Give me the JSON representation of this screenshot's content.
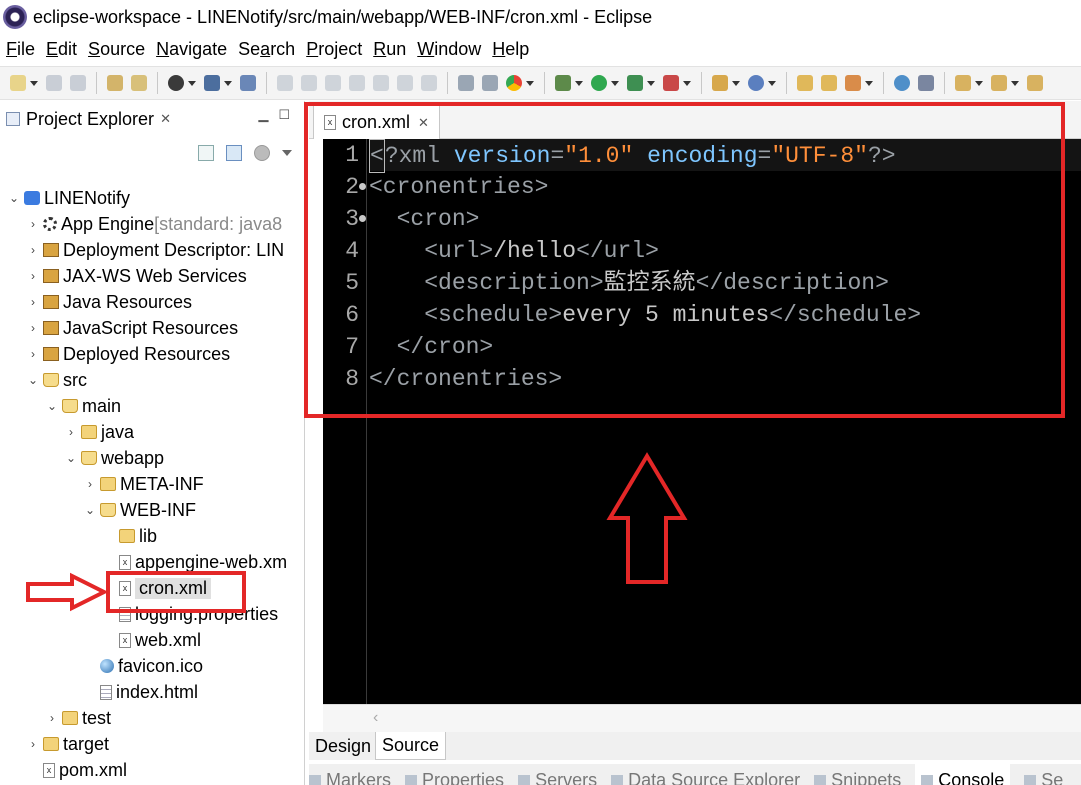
{
  "window": {
    "title": "eclipse-workspace - LINENotify/src/main/webapp/WEB-INF/cron.xml - Eclipse"
  },
  "menu": [
    {
      "label": "File",
      "mnemonic": "F",
      "rest": "ile"
    },
    {
      "label": "Edit",
      "mnemonic": "E",
      "rest": "dit"
    },
    {
      "label": "Source",
      "mnemonic": "S",
      "rest": "ource"
    },
    {
      "label": "Navigate",
      "mnemonic": "N",
      "rest": "avigate"
    },
    {
      "label": "Search",
      "pre": "Se",
      "mnemonic": "a",
      "rest": "rch"
    },
    {
      "label": "Project",
      "mnemonic": "P",
      "rest": "roject"
    },
    {
      "label": "Run",
      "mnemonic": "R",
      "rest": "un"
    },
    {
      "label": "Window",
      "mnemonic": "W",
      "rest": "indow"
    },
    {
      "label": "Help",
      "mnemonic": "H",
      "rest": "elp"
    }
  ],
  "explorer": {
    "title": "Project Explorer",
    "tree": [
      {
        "label": "LINENotify",
        "depth": 0,
        "twisty": "open",
        "icon": "project-icon"
      },
      {
        "label": "App Engine",
        "suffix": " [standard: java8",
        "depth": 1,
        "twisty": "closed",
        "icon": "gear-icon"
      },
      {
        "label": "Deployment Descriptor: LIN",
        "depth": 1,
        "twisty": "closed",
        "icon": "descriptor-icon"
      },
      {
        "label": "JAX-WS Web Services",
        "depth": 1,
        "twisty": "closed",
        "icon": "webservice-icon"
      },
      {
        "label": "Java Resources",
        "depth": 1,
        "twisty": "closed",
        "icon": "java-resources-icon"
      },
      {
        "label": "JavaScript Resources",
        "depth": 1,
        "twisty": "closed",
        "icon": "javascript-resources-icon"
      },
      {
        "label": "Deployed Resources",
        "depth": 1,
        "twisty": "closed",
        "icon": "deployed-resources-icon"
      },
      {
        "label": "src",
        "depth": 1,
        "twisty": "open",
        "icon": "folder-open-icon"
      },
      {
        "label": "main",
        "depth": 2,
        "twisty": "open",
        "icon": "folder-open-icon"
      },
      {
        "label": "java",
        "depth": 3,
        "twisty": "closed",
        "icon": "folder-icon"
      },
      {
        "label": "webapp",
        "depth": 3,
        "twisty": "open",
        "icon": "folder-open-icon"
      },
      {
        "label": "META-INF",
        "depth": 4,
        "twisty": "closed",
        "icon": "folder-icon"
      },
      {
        "label": "WEB-INF",
        "depth": 4,
        "twisty": "open",
        "icon": "folder-open-icon"
      },
      {
        "label": "lib",
        "depth": 5,
        "twisty": "none",
        "icon": "folder-icon"
      },
      {
        "label": "appengine-web.xm",
        "depth": 5,
        "twisty": "none",
        "icon": "xml-file-icon"
      },
      {
        "label": "cron.xml",
        "depth": 5,
        "twisty": "none",
        "icon": "xml-file-icon",
        "selected": true
      },
      {
        "label": "logging.properties",
        "depth": 5,
        "twisty": "none",
        "icon": "properties-file-icon"
      },
      {
        "label": "web.xml",
        "depth": 5,
        "twisty": "none",
        "icon": "xml-file-icon"
      },
      {
        "label": "favicon.ico",
        "depth": 4,
        "twisty": "none",
        "icon": "image-file-icon"
      },
      {
        "label": "index.html",
        "depth": 4,
        "twisty": "none",
        "icon": "html-file-icon"
      },
      {
        "label": "test",
        "depth": 2,
        "twisty": "closed",
        "icon": "folder-icon"
      },
      {
        "label": "target",
        "depth": 1,
        "twisty": "closed",
        "icon": "folder-icon"
      },
      {
        "label": "pom.xml",
        "depth": 1,
        "twisty": "none",
        "icon": "maven-file-icon"
      }
    ]
  },
  "editor": {
    "tab_label": "cron.xml",
    "lines": [
      {
        "n": "1",
        "parts": [
          [
            "cursor",
            "<"
          ],
          [
            "tag",
            "?xml "
          ],
          [
            "kw",
            "version"
          ],
          [
            "tag",
            "="
          ],
          [
            "str",
            "\"1.0\""
          ],
          [
            "tag",
            " "
          ],
          [
            "kw",
            "encoding"
          ],
          [
            "tag",
            "="
          ],
          [
            "str",
            "\"UTF-8\""
          ],
          [
            "tag",
            "?>"
          ]
        ]
      },
      {
        "n": "2",
        "fold": true,
        "parts": [
          [
            "tag",
            "<cronentries>"
          ]
        ]
      },
      {
        "n": "3",
        "fold": true,
        "parts": [
          [
            "tag",
            "  <cron>"
          ]
        ]
      },
      {
        "n": "4",
        "parts": [
          [
            "tag",
            "    <url>"
          ],
          [
            "txt",
            "/hello"
          ],
          [
            "tag",
            "</url>"
          ]
        ]
      },
      {
        "n": "5",
        "parts": [
          [
            "tag",
            "    <description>"
          ],
          [
            "txt",
            "監控系統"
          ],
          [
            "tag",
            "</description>"
          ]
        ]
      },
      {
        "n": "6",
        "parts": [
          [
            "tag",
            "    <schedule>"
          ],
          [
            "txt",
            "every 5 minutes"
          ],
          [
            "tag",
            "</schedule>"
          ]
        ]
      },
      {
        "n": "7",
        "parts": [
          [
            "tag",
            "  </cron>"
          ]
        ]
      },
      {
        "n": "8",
        "parts": [
          [
            "tag",
            "</cronentries>"
          ]
        ]
      }
    ],
    "modes": [
      "Design",
      "Source"
    ],
    "active_mode": "Source"
  },
  "bottom_tabs": [
    "Markers",
    "Properties",
    "Servers",
    "Data Source Explorer",
    "Snippets",
    "Console",
    "Se"
  ],
  "active_bottom_tab": "Console",
  "colors": {
    "annotation_red": "#e32727",
    "editor_bg": "#000000",
    "xml_attribute": "#7ec6ff",
    "xml_string": "#ff8f3a"
  }
}
